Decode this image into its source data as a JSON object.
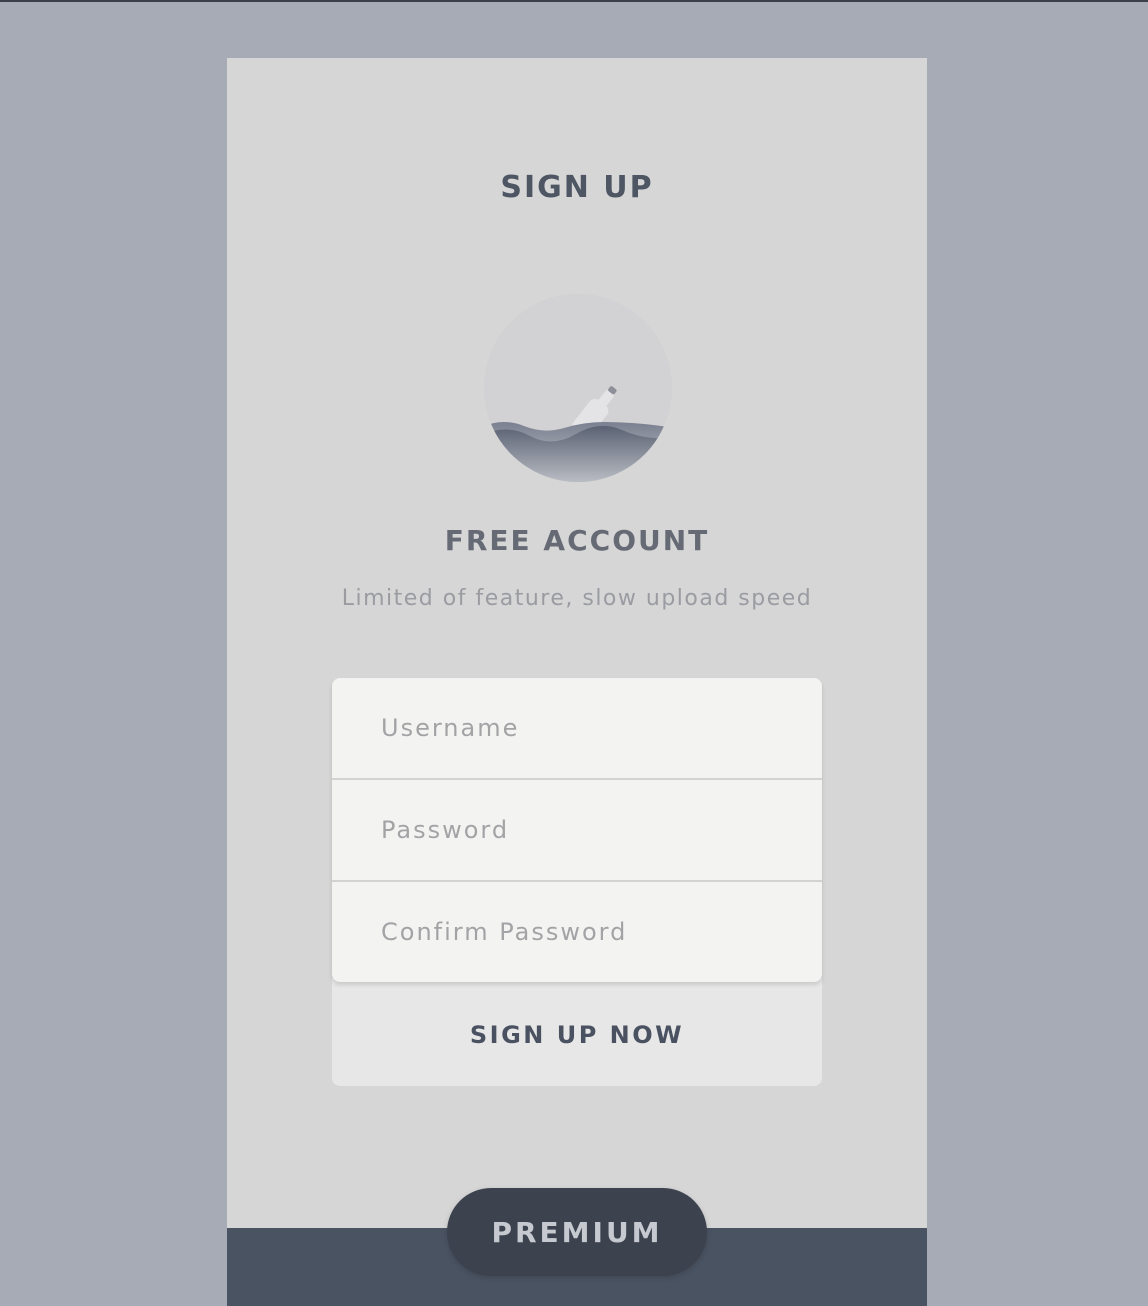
{
  "header": {
    "title": "SIGN UP"
  },
  "plan": {
    "title": "FREE ACCOUNT",
    "subtitle": "Limited of feature, slow upload speed",
    "icon": "bottle-in-sea-icon"
  },
  "form": {
    "username": {
      "value": "",
      "placeholder": "Username"
    },
    "password": {
      "value": "",
      "placeholder": "Password"
    },
    "confirm_password": {
      "value": "",
      "placeholder": "Confirm Password"
    },
    "submit_label": "SIGN UP NOW"
  },
  "footer": {
    "premium_label": "PREMIUM"
  },
  "colors": {
    "background": "#a6abb5",
    "card": "#d6d6d6",
    "accent": "#4a5362",
    "field": "#f3f3f2"
  }
}
